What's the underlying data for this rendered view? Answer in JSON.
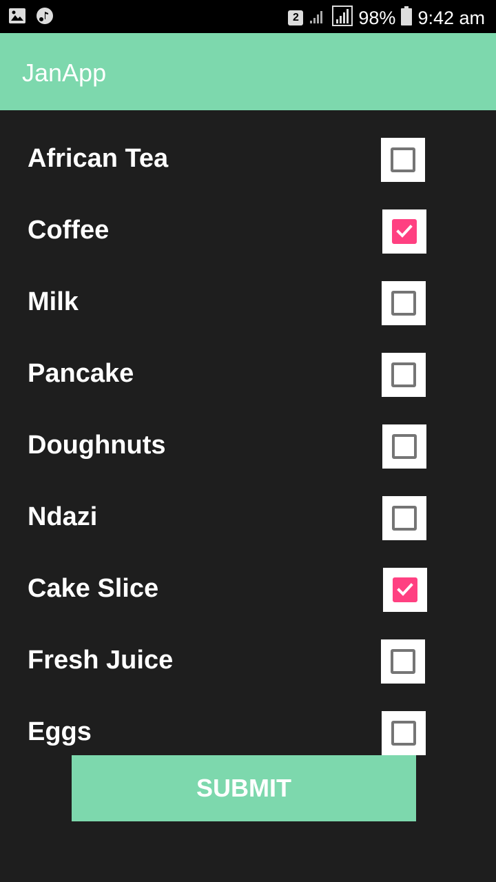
{
  "status_bar": {
    "sim_badge": "2",
    "battery": "98%",
    "time": "9:42 am"
  },
  "app_bar": {
    "title": "JanApp"
  },
  "items": [
    {
      "label": "African Tea",
      "checked": false
    },
    {
      "label": "Coffee",
      "checked": true
    },
    {
      "label": "Milk",
      "checked": false
    },
    {
      "label": "Pancake",
      "checked": false
    },
    {
      "label": "Doughnuts",
      "checked": false
    },
    {
      "label": "Ndazi",
      "checked": false
    },
    {
      "label": "Cake Slice",
      "checked": true
    },
    {
      "label": "Fresh Juice",
      "checked": false
    },
    {
      "label": "Eggs",
      "checked": false
    }
  ],
  "submit": {
    "label": "SUBMIT"
  },
  "colors": {
    "accent": "#7dd8ad",
    "checked": "#ff4081",
    "background": "#1e1e1e"
  }
}
